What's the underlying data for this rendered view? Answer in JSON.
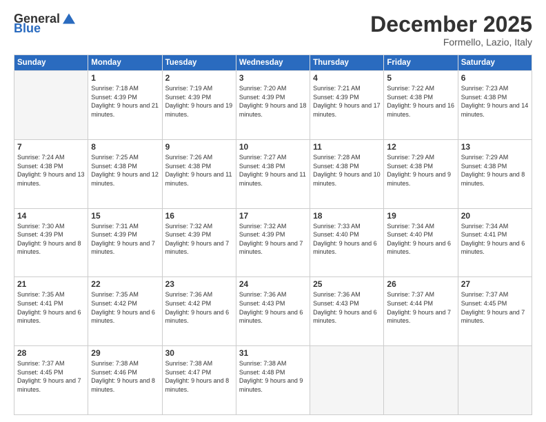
{
  "header": {
    "logo_general": "General",
    "logo_blue": "Blue",
    "month_title": "December 2025",
    "location": "Formello, Lazio, Italy"
  },
  "weekdays": [
    "Sunday",
    "Monday",
    "Tuesday",
    "Wednesday",
    "Thursday",
    "Friday",
    "Saturday"
  ],
  "weeks": [
    [
      {
        "day": "",
        "empty": true
      },
      {
        "day": "1",
        "sunrise": "7:18 AM",
        "sunset": "4:39 PM",
        "daylight": "9 hours and 21 minutes."
      },
      {
        "day": "2",
        "sunrise": "7:19 AM",
        "sunset": "4:39 PM",
        "daylight": "9 hours and 19 minutes."
      },
      {
        "day": "3",
        "sunrise": "7:20 AM",
        "sunset": "4:39 PM",
        "daylight": "9 hours and 18 minutes."
      },
      {
        "day": "4",
        "sunrise": "7:21 AM",
        "sunset": "4:39 PM",
        "daylight": "9 hours and 17 minutes."
      },
      {
        "day": "5",
        "sunrise": "7:22 AM",
        "sunset": "4:38 PM",
        "daylight": "9 hours and 16 minutes."
      },
      {
        "day": "6",
        "sunrise": "7:23 AM",
        "sunset": "4:38 PM",
        "daylight": "9 hours and 14 minutes."
      }
    ],
    [
      {
        "day": "7",
        "sunrise": "7:24 AM",
        "sunset": "4:38 PM",
        "daylight": "9 hours and 13 minutes."
      },
      {
        "day": "8",
        "sunrise": "7:25 AM",
        "sunset": "4:38 PM",
        "daylight": "9 hours and 12 minutes."
      },
      {
        "day": "9",
        "sunrise": "7:26 AM",
        "sunset": "4:38 PM",
        "daylight": "9 hours and 11 minutes."
      },
      {
        "day": "10",
        "sunrise": "7:27 AM",
        "sunset": "4:38 PM",
        "daylight": "9 hours and 11 minutes."
      },
      {
        "day": "11",
        "sunrise": "7:28 AM",
        "sunset": "4:38 PM",
        "daylight": "9 hours and 10 minutes."
      },
      {
        "day": "12",
        "sunrise": "7:29 AM",
        "sunset": "4:38 PM",
        "daylight": "9 hours and 9 minutes."
      },
      {
        "day": "13",
        "sunrise": "7:29 AM",
        "sunset": "4:38 PM",
        "daylight": "9 hours and 8 minutes."
      }
    ],
    [
      {
        "day": "14",
        "sunrise": "7:30 AM",
        "sunset": "4:39 PM",
        "daylight": "9 hours and 8 minutes."
      },
      {
        "day": "15",
        "sunrise": "7:31 AM",
        "sunset": "4:39 PM",
        "daylight": "9 hours and 7 minutes."
      },
      {
        "day": "16",
        "sunrise": "7:32 AM",
        "sunset": "4:39 PM",
        "daylight": "9 hours and 7 minutes."
      },
      {
        "day": "17",
        "sunrise": "7:32 AM",
        "sunset": "4:39 PM",
        "daylight": "9 hours and 7 minutes."
      },
      {
        "day": "18",
        "sunrise": "7:33 AM",
        "sunset": "4:40 PM",
        "daylight": "9 hours and 6 minutes."
      },
      {
        "day": "19",
        "sunrise": "7:34 AM",
        "sunset": "4:40 PM",
        "daylight": "9 hours and 6 minutes."
      },
      {
        "day": "20",
        "sunrise": "7:34 AM",
        "sunset": "4:41 PM",
        "daylight": "9 hours and 6 minutes."
      }
    ],
    [
      {
        "day": "21",
        "sunrise": "7:35 AM",
        "sunset": "4:41 PM",
        "daylight": "9 hours and 6 minutes."
      },
      {
        "day": "22",
        "sunrise": "7:35 AM",
        "sunset": "4:42 PM",
        "daylight": "9 hours and 6 minutes."
      },
      {
        "day": "23",
        "sunrise": "7:36 AM",
        "sunset": "4:42 PM",
        "daylight": "9 hours and 6 minutes."
      },
      {
        "day": "24",
        "sunrise": "7:36 AM",
        "sunset": "4:43 PM",
        "daylight": "9 hours and 6 minutes."
      },
      {
        "day": "25",
        "sunrise": "7:36 AM",
        "sunset": "4:43 PM",
        "daylight": "9 hours and 6 minutes."
      },
      {
        "day": "26",
        "sunrise": "7:37 AM",
        "sunset": "4:44 PM",
        "daylight": "9 hours and 7 minutes."
      },
      {
        "day": "27",
        "sunrise": "7:37 AM",
        "sunset": "4:45 PM",
        "daylight": "9 hours and 7 minutes."
      }
    ],
    [
      {
        "day": "28",
        "sunrise": "7:37 AM",
        "sunset": "4:45 PM",
        "daylight": "9 hours and 7 minutes."
      },
      {
        "day": "29",
        "sunrise": "7:38 AM",
        "sunset": "4:46 PM",
        "daylight": "9 hours and 8 minutes."
      },
      {
        "day": "30",
        "sunrise": "7:38 AM",
        "sunset": "4:47 PM",
        "daylight": "9 hours and 8 minutes."
      },
      {
        "day": "31",
        "sunrise": "7:38 AM",
        "sunset": "4:48 PM",
        "daylight": "9 hours and 9 minutes."
      },
      {
        "day": "",
        "empty": true
      },
      {
        "day": "",
        "empty": true
      },
      {
        "day": "",
        "empty": true
      }
    ]
  ]
}
